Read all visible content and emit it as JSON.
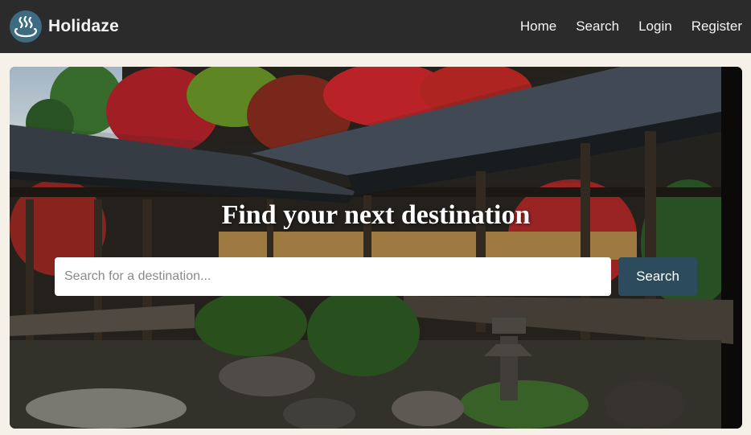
{
  "brand": {
    "name": "Holidaze",
    "logo_icon": "hot-spring-icon",
    "logo_bg": "#3d6b82"
  },
  "nav": {
    "links": [
      "Home",
      "Search",
      "Login",
      "Register"
    ]
  },
  "hero": {
    "title": "Find your next destination",
    "image": "japanese-temple-garden-photo",
    "search": {
      "placeholder": "Search for a destination...",
      "value": "",
      "button_label": "Search"
    }
  },
  "colors": {
    "navbar_bg": "#2b2b2b",
    "page_bg": "#f5f0e8",
    "button_bg": "#2c4c5e"
  }
}
